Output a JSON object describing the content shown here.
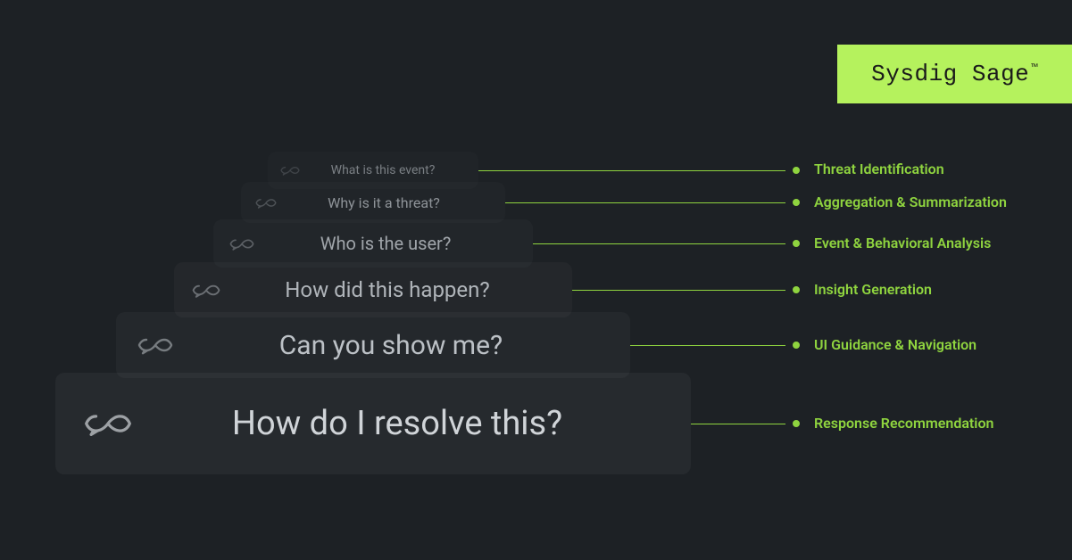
{
  "brand": {
    "name": "Sysdig Sage",
    "trademark": "™"
  },
  "colors": {
    "accent": "#8fd43f",
    "badge_bg": "#b5f25d",
    "bg": "#1d2125"
  },
  "icon_name": "infinity-chat-icon",
  "tiers": [
    {
      "question": "What is this event?",
      "feature": "Threat Identification"
    },
    {
      "question": "Why is it a threat?",
      "feature": "Aggregation & Summarization"
    },
    {
      "question": "Who is the user?",
      "feature": "Event & Behavioral Analysis"
    },
    {
      "question": "How did this happen?",
      "feature": "Insight Generation"
    },
    {
      "question": "Can you show me?",
      "feature": "UI Guidance & Navigation"
    },
    {
      "question": "How do I resolve this?",
      "feature": "Response Recommendation"
    }
  ]
}
